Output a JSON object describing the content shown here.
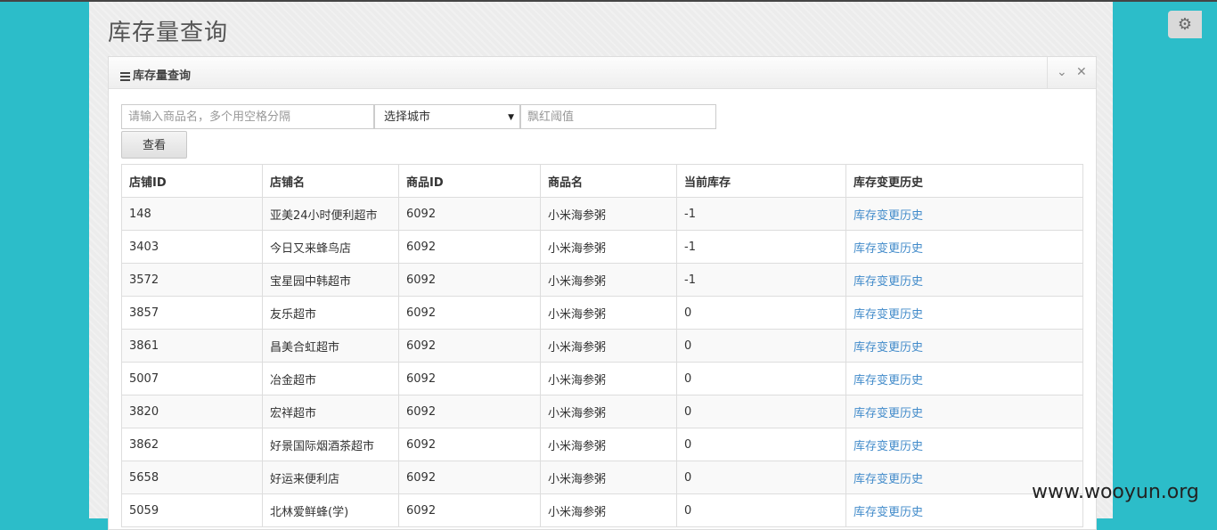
{
  "page": {
    "title": "库存量查询"
  },
  "panel": {
    "title": "库存量查询"
  },
  "search": {
    "product_placeholder": "请输入商品名，多个用空格分隔",
    "city_selected": "选择城市",
    "threshold_placeholder": "飘红阈值",
    "submit_label": "查看"
  },
  "table": {
    "headers": [
      "店铺ID",
      "店铺名",
      "商品ID",
      "商品名",
      "当前库存",
      "库存变更历史"
    ],
    "rows": [
      [
        "148",
        "亚美24小时便利超市",
        "6092",
        "小米海参粥",
        "-1",
        "库存变更历史"
      ],
      [
        "3403",
        "今日又来蜂鸟店",
        "6092",
        "小米海参粥",
        "-1",
        "库存变更历史"
      ],
      [
        "3572",
        "宝星园中韩超市",
        "6092",
        "小米海参粥",
        "-1",
        "库存变更历史"
      ],
      [
        "3857",
        "友乐超市",
        "6092",
        "小米海参粥",
        "0",
        "库存变更历史"
      ],
      [
        "3861",
        "昌美合虹超市",
        "6092",
        "小米海参粥",
        "0",
        "库存变更历史"
      ],
      [
        "5007",
        "冶金超市",
        "6092",
        "小米海参粥",
        "0",
        "库存变更历史"
      ],
      [
        "3820",
        "宏祥超市",
        "6092",
        "小米海参粥",
        "0",
        "库存变更历史"
      ],
      [
        "3862",
        "好景国际烟酒茶超市",
        "6092",
        "小米海参粥",
        "0",
        "库存变更历史"
      ],
      [
        "5658",
        "好运来便利店",
        "6092",
        "小米海参粥",
        "0",
        "库存变更历史"
      ],
      [
        "5059",
        "北林爱鲜蜂(学)",
        "6092",
        "小米海参粥",
        "0",
        "库存变更历史"
      ]
    ]
  },
  "icons": {
    "panel_menu": "menu-icon",
    "collapse": "chevron-down-icon",
    "close": "close-icon",
    "settings": "gears-icon"
  },
  "watermark": "www.wooyun.org",
  "colors": {
    "background": "#2cbdc9",
    "link": "#428bca"
  }
}
